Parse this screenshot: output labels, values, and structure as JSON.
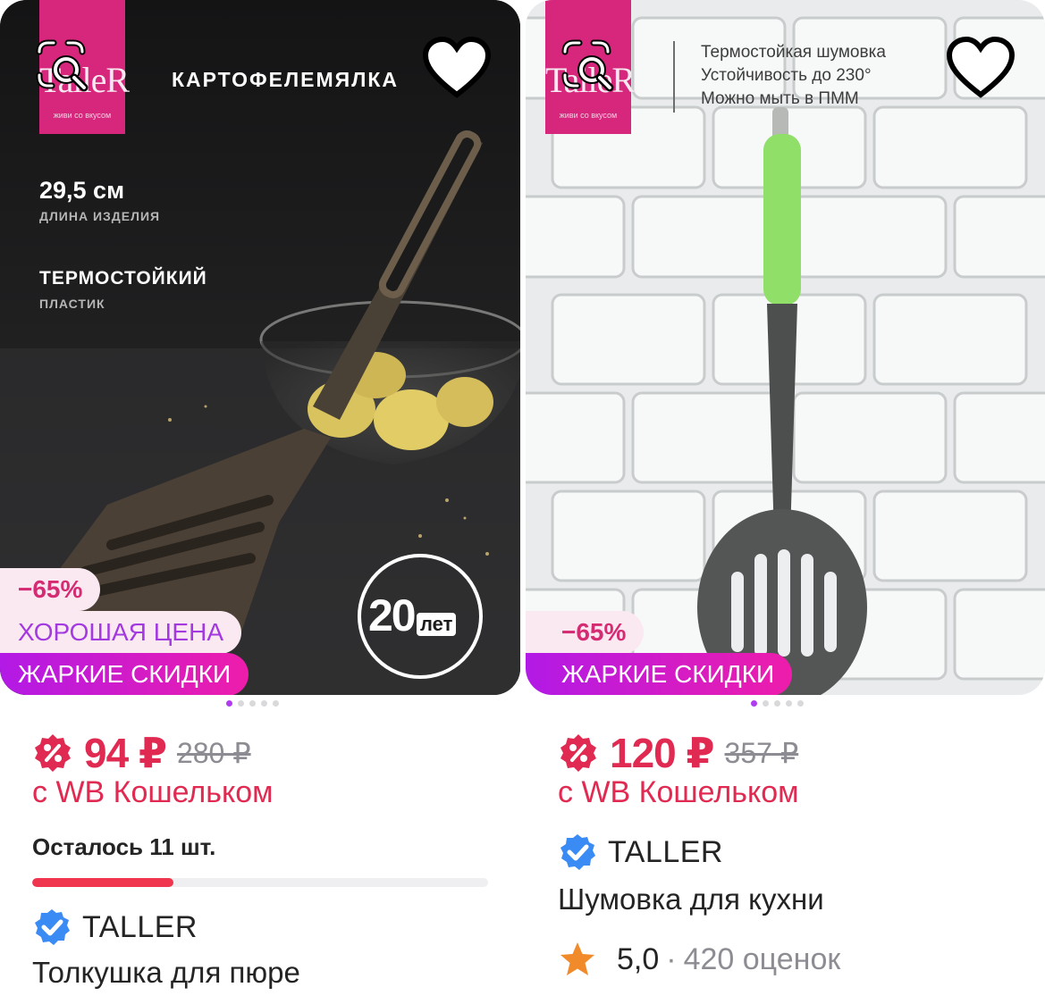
{
  "products": [
    {
      "brand_logo": {
        "text": "TalleR",
        "slogan": "живи со вкусом"
      },
      "promo": {
        "title": "КАРТОФЕЛЕМЯЛКА",
        "length_value": "29,5 см",
        "length_label": "ДЛИНА ИЗДЕЛИЯ",
        "material_value": "ТЕРМОСТОЙКИЙ",
        "material_label": "ПЛАСТИК",
        "guarantee_number": "20",
        "guarantee_unit": "лет"
      },
      "badges": {
        "discount": "−65%",
        "good_price": "ХОРОШАЯ ЦЕНА",
        "hot_deal": "ЖАРКИЕ СКИДКИ"
      },
      "price_now": "94 ₽",
      "price_old": "280 ₽",
      "wallet_note": "с WB Кошельком",
      "stock_note": "Осталось 11 шт.",
      "stock_level": 0.31,
      "brand": "TALLER",
      "name": "Толкушка для пюре"
    },
    {
      "brand_logo": {
        "text": "TalleR",
        "slogan": "живи со вкусом"
      },
      "promo": {
        "lines": [
          "Термостойкая шумовка",
          "Устойчивость до 230°",
          "Можно мыть в ПММ"
        ]
      },
      "badges": {
        "discount": "−65%",
        "hot_deal": "ЖАРКИЕ СКИДКИ"
      },
      "price_now": "120 ₽",
      "price_old": "357 ₽",
      "wallet_note": "с WB Кошельком",
      "brand": "TALLER",
      "name": "Шумовка для кухни",
      "rating": {
        "value": "5,0",
        "separator": "·",
        "count": "420 оценок"
      }
    }
  ],
  "icons": {
    "photo_search": "photo-search-icon",
    "favorite": "heart-icon",
    "wallet_discount": "wallet-discount-icon",
    "verified": "verified-check-icon",
    "rating": "star-icon"
  },
  "colors": {
    "price": "#e02a52",
    "verified": "#3b8bf5",
    "hot_gradient_start": "#b21ae6",
    "hot_gradient_end": "#ee1dab",
    "star": "#f08a2a"
  }
}
